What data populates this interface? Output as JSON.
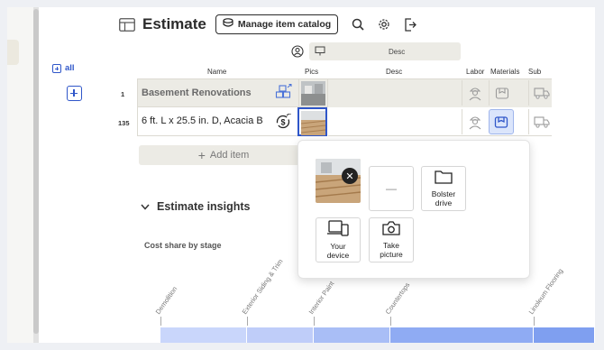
{
  "header": {
    "title": "Estimate",
    "catalog_button": "Manage item catalog",
    "icons": [
      "table-icon",
      "catalog-icon",
      "search-icon",
      "gear-icon",
      "export-icon"
    ]
  },
  "toolbar": {
    "all_label": "all",
    "desc_header": "Desc"
  },
  "columns": [
    "Name",
    "Pics",
    "Desc",
    "Labor",
    "Materials",
    "Sub"
  ],
  "rows": [
    {
      "num": "1",
      "name": "Basement Renovations"
    },
    {
      "num": "135",
      "name": "6 ft. L x 25.5 in. D, Acacia B"
    }
  ],
  "add_item_label": "Add item",
  "insights": {
    "title": "Estimate insights",
    "cost_share_label": "Cost share by stage",
    "stages": [
      "Demolition",
      "Exterior Siding & Trim",
      "Interior Paint",
      "Countertops",
      "Linoleum Flooring"
    ]
  },
  "popover": {
    "empty_tile": "—",
    "bolster_drive": [
      "Bolster",
      "drive"
    ],
    "your_device": [
      "Your",
      "device"
    ],
    "take_picture": [
      "Take",
      "picture"
    ]
  },
  "colors": {
    "accent": "#2f56c9",
    "row_bg": "#ecebe5",
    "bar_light": "#c9d6fb",
    "bar_mid": "#a9bef6",
    "bar_dark": "#7f9ff0"
  }
}
